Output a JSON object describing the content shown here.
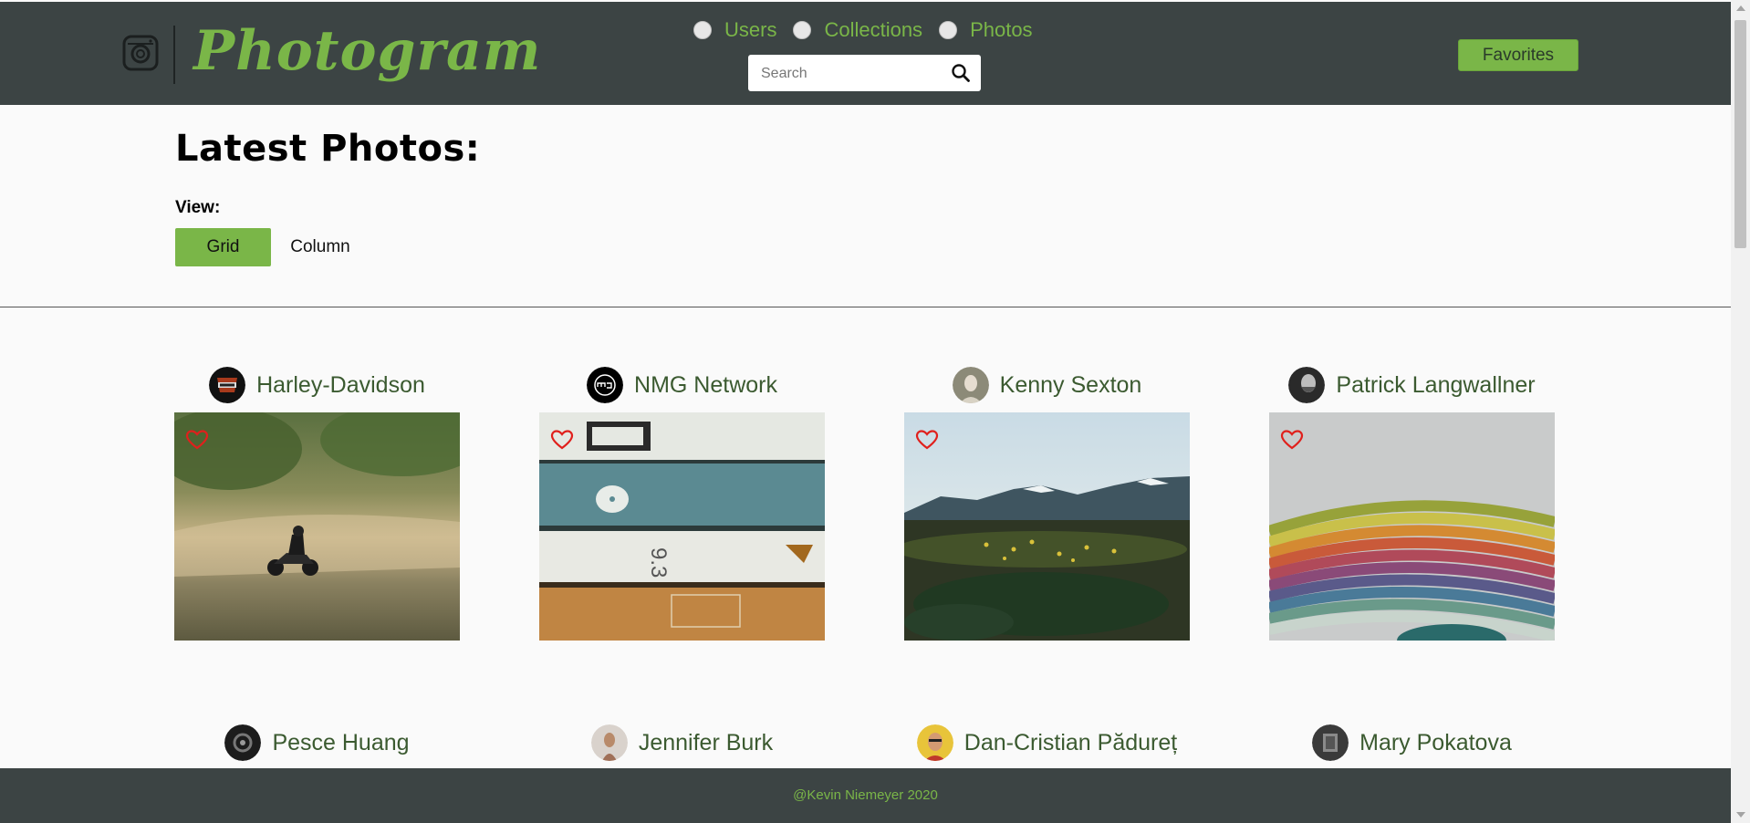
{
  "header": {
    "logo_text": "Photogram",
    "nav": [
      {
        "label": "Users"
      },
      {
        "label": "Collections"
      },
      {
        "label": "Photos"
      }
    ],
    "search_placeholder": "Search",
    "favorites_label": "Favorites"
  },
  "main": {
    "title": "Latest Photos:",
    "view_label": "View:",
    "view_options": [
      {
        "label": "Grid",
        "selected": true
      },
      {
        "label": "Column",
        "selected": false
      }
    ]
  },
  "cards": [
    {
      "name": "Harley-Davidson",
      "liked": false
    },
    {
      "name": "NMG Network",
      "liked": false
    },
    {
      "name": "Kenny Sexton",
      "liked": false
    },
    {
      "name": "Patrick Langwallner",
      "liked": false
    },
    {
      "name": "Pesce Huang",
      "liked": false
    },
    {
      "name": "Jennifer Burk",
      "liked": false
    },
    {
      "name": "Dan-Cristian Pădureț",
      "liked": false
    },
    {
      "name": "Mary Pokatova",
      "liked": false
    }
  ],
  "footer": {
    "text": "@Kevin Niemeyer 2020"
  },
  "colors": {
    "header_bg": "#3c4444",
    "accent": "#7ab648",
    "card_name": "#3b5a30",
    "heart": "#e0201c"
  }
}
